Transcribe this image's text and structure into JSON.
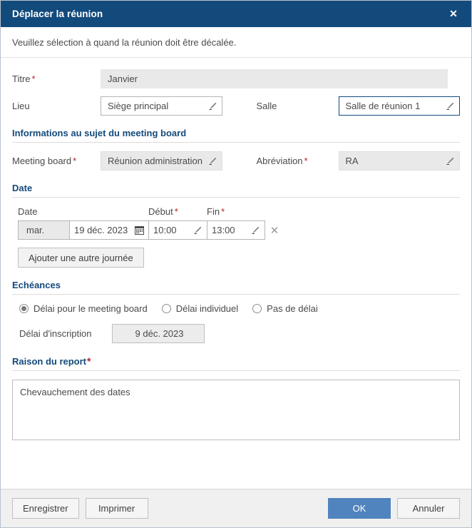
{
  "dialog": {
    "title": "Déplacer la réunion",
    "close_icon": "close-icon",
    "intro": "Veuillez sélection à quand la réunion doit être décalée."
  },
  "form": {
    "titre": {
      "label": "Titre",
      "required": "*",
      "value": "Janvier"
    },
    "lieu": {
      "label": "Lieu",
      "value": "Siège principal"
    },
    "salle": {
      "label": "Salle",
      "value": "Salle de réunion 1"
    }
  },
  "meeting_board_section": {
    "heading": "Informations au sujet du meeting board",
    "meeting_board": {
      "label": "Meeting board",
      "required": "*",
      "value": "Réunion administration"
    },
    "abreviation": {
      "label": "Abréviation",
      "required": "*",
      "value": "RA"
    }
  },
  "date_section": {
    "heading": "Date",
    "columns": {
      "date": "Date",
      "debut": "Début",
      "fin": "Fin",
      "debut_required": "*",
      "fin_required": "*"
    },
    "rows": [
      {
        "day": "mar.",
        "date": "19 déc. 2023",
        "start": "10:00",
        "end": "13:00",
        "calendar_icon": "calendar-icon",
        "remove_icon": "✕"
      }
    ],
    "add_button": "Ajouter une autre journée"
  },
  "deadlines_section": {
    "heading": "Echéances",
    "options": [
      {
        "label": "Délai pour le meeting board",
        "selected": true
      },
      {
        "label": "Délai individuel",
        "selected": false
      },
      {
        "label": "Pas de délai",
        "selected": false
      }
    ],
    "registration": {
      "label": "Délai d'inscription",
      "value": "9 déc. 2023"
    }
  },
  "reason_section": {
    "heading": "Raison du report",
    "required": "*",
    "value": "Chevauchement des dates"
  },
  "footer": {
    "save": "Enregistrer",
    "print": "Imprimer",
    "ok": "OK",
    "cancel": "Annuler"
  },
  "colors": {
    "titlebar": "#134A7C",
    "accent": "#5084BE",
    "required": "#b4232b",
    "section_heading": "#134A7C"
  }
}
